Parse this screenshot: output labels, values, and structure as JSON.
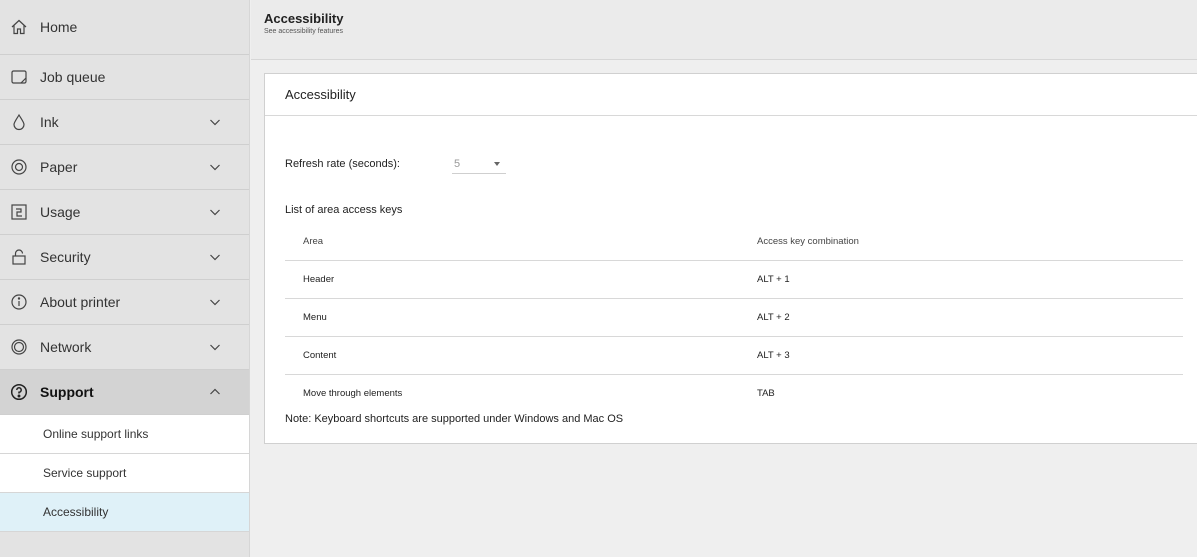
{
  "sidebar": {
    "items": [
      {
        "label": "Home",
        "icon": "home-icon",
        "expandable": false
      },
      {
        "label": "Job queue",
        "icon": "job-queue-icon",
        "expandable": false
      },
      {
        "label": "Ink",
        "icon": "ink-drop-icon",
        "expandable": true
      },
      {
        "label": "Paper",
        "icon": "paper-roll-icon",
        "expandable": true
      },
      {
        "label": "Usage",
        "icon": "usage-icon",
        "expandable": true
      },
      {
        "label": "Security",
        "icon": "lock-icon",
        "expandable": true
      },
      {
        "label": "About printer",
        "icon": "info-icon",
        "expandable": true
      },
      {
        "label": "Network",
        "icon": "network-icon",
        "expandable": true
      },
      {
        "label": "Support",
        "icon": "help-icon",
        "expandable": true,
        "expanded": true
      }
    ],
    "support_subitems": [
      {
        "label": "Online support links"
      },
      {
        "label": "Service support"
      },
      {
        "label": "Accessibility",
        "selected": true
      }
    ]
  },
  "header": {
    "title": "Accessibility",
    "subtitle": "See accessibility features"
  },
  "card": {
    "title": "Accessibility",
    "refresh_label": "Refresh rate (seconds):",
    "refresh_value": "5",
    "list_title": "List of area access keys",
    "columns": [
      "Area",
      "Access key combination"
    ],
    "rows": [
      {
        "area": "Header",
        "keys": "ALT + 1"
      },
      {
        "area": "Menu",
        "keys": "ALT + 2"
      },
      {
        "area": "Content",
        "keys": "ALT + 3"
      },
      {
        "area": "Move through elements",
        "keys": "TAB"
      }
    ],
    "note": "Note: Keyboard shortcuts are supported under Windows and Mac OS"
  },
  "colors": {
    "sidebar_bg": "#e3e3e3",
    "active_bg": "#d3d3d3",
    "selected_sub_bg": "#dff1f8",
    "page_bg": "#efefef"
  }
}
